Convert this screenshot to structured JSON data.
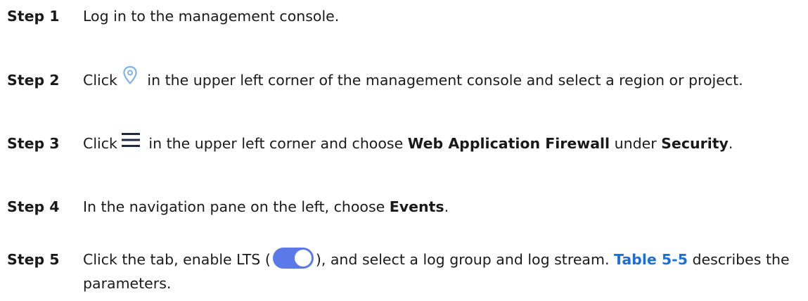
{
  "steps": [
    {
      "label": "Step 1",
      "t1": "Log in to the management console."
    },
    {
      "label": "Step 2",
      "t1": "Click",
      "icon": "location-pin-icon",
      "t2": " in the upper left corner of the management console and select a region or project."
    },
    {
      "label": "Step 3",
      "t1": "Click",
      "icon": "menu-hamburger-icon",
      "t2": " in the upper left corner and choose ",
      "b1": "Web Application Firewall",
      "t3": " under ",
      "b2": "Security",
      "t4": "."
    },
    {
      "label": "Step 4",
      "t1": "In the navigation pane on the left, choose ",
      "b1": "Events",
      "t2": "."
    },
    {
      "label": "Step 5",
      "t1": "Click the tab, enable LTS (",
      "icon": "toggle-switch-on-icon",
      "t2": "), and select a log group and log stream. ",
      "link": "Table 5-5",
      "t3": " describes the parameters."
    }
  ],
  "colors": {
    "link": "#1d6fd8",
    "toggle_on": "#5b79e8",
    "location_icon": "#7fb2e6",
    "menu_icon": "#1f2a44"
  }
}
